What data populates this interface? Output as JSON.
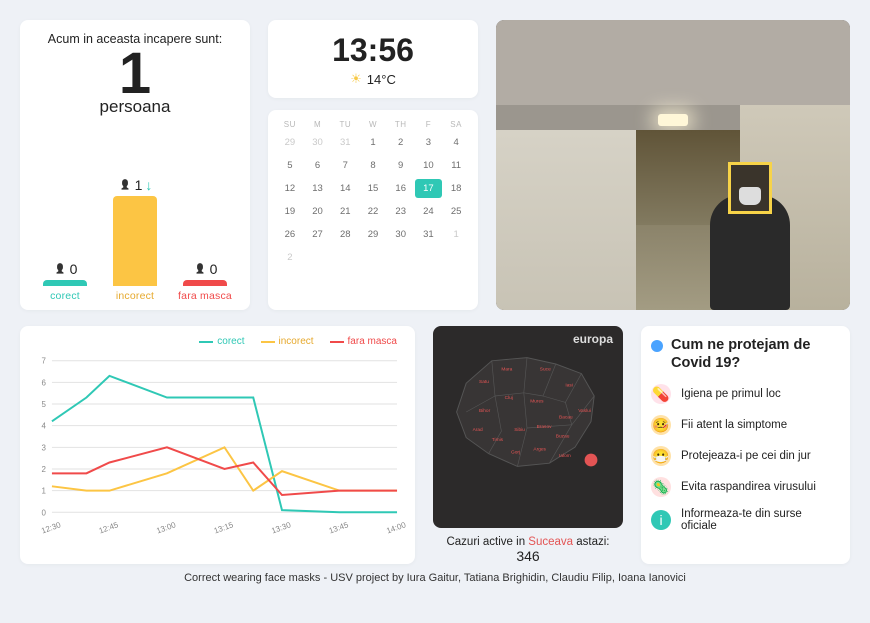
{
  "people_panel": {
    "title": "Acum in aceasta incapere  sunt:",
    "count": "1",
    "unit": "persoana",
    "bars": {
      "corect": {
        "count": "0",
        "label": "corect"
      },
      "incorect": {
        "count": "1",
        "label": "incorect",
        "trend_icon": "arrow-down"
      },
      "nomask": {
        "count": "0",
        "label": "fara masca"
      }
    }
  },
  "clock": {
    "time": "13:56",
    "weather": {
      "icon": "sun-icon",
      "temp": "14°C"
    }
  },
  "calendar": {
    "dow": [
      "SU",
      "M",
      "TU",
      "W",
      "TH",
      "F",
      "SA"
    ],
    "leading_dim": [
      "29",
      "30",
      "31"
    ],
    "days": [
      "1",
      "2",
      "3",
      "4",
      "5",
      "6",
      "7",
      "8",
      "9",
      "10",
      "11",
      "12",
      "13",
      "14",
      "15",
      "16",
      "17",
      "18",
      "19",
      "20",
      "21",
      "22",
      "23",
      "24",
      "25",
      "26",
      "27",
      "28",
      "29",
      "30",
      "31"
    ],
    "trailing_dim": [
      "1",
      "2"
    ],
    "today": "17"
  },
  "chart_panel": {
    "legend": {
      "corect": "corect",
      "incorect": "incorect",
      "nomask": "fara masca"
    }
  },
  "chart_data": {
    "type": "line",
    "title": "",
    "xlabel": "",
    "ylabel": "",
    "ylim": [
      0,
      7
    ],
    "yticks": [
      0,
      1,
      2,
      3,
      4,
      5,
      6,
      7
    ],
    "categories": [
      "12:30",
      "12:45",
      "13:00",
      "13:15",
      "13:30",
      "13:45",
      "14:00"
    ],
    "series": [
      {
        "name": "corect",
        "color": "#2fc8b5",
        "values": [
          4.2,
          5.3,
          6.3,
          5.3,
          5.3,
          5.3,
          0.1,
          0.0,
          0.0
        ]
      },
      {
        "name": "incorect",
        "color": "#fcc544",
        "values": [
          1.2,
          1.0,
          1.0,
          1.8,
          3.0,
          1.0,
          1.9,
          1.0,
          1.0
        ]
      },
      {
        "name": "fara masca",
        "color": "#f04a4a",
        "values": [
          1.8,
          1.8,
          2.3,
          3.0,
          2.0,
          2.3,
          0.8,
          1.0,
          1.0
        ]
      }
    ],
    "x_positions_index": [
      0,
      0.6,
      1,
      2,
      3,
      3.5,
      4,
      5,
      6
    ]
  },
  "map_panel": {
    "brand": "europa",
    "caption_prefix": "Cazuri active in ",
    "caption_region": "Suceava",
    "caption_suffix": " astazi:",
    "caption_value": "346"
  },
  "tips_panel": {
    "title": "Cum ne protejam de Covid 19?",
    "items": [
      {
        "icon": "pill-icon",
        "bg": "#ffe2ea",
        "glyph": "💊",
        "text": "Igiena pe primul loc"
      },
      {
        "icon": "sick-icon",
        "bg": "#ffe2a8",
        "glyph": "🤒",
        "text": "Fii atent la simptome"
      },
      {
        "icon": "mask-icon",
        "bg": "#ffe2a8",
        "glyph": "😷",
        "text": "Protejeaza-i pe cei din jur"
      },
      {
        "icon": "virus-icon",
        "bg": "#ffe0e0",
        "glyph": "🦠",
        "text": "Evita raspandirea virusului"
      },
      {
        "icon": "info-icon",
        "bg": "#2fc8b5",
        "glyph": "i",
        "text": "Informeaza-te din surse oficiale"
      }
    ]
  },
  "footer": "Correct wearing face masks - USV  project by Iura Gaitur, Tatiana Brighidin, Claudiu Filip, Ioana Ianovici"
}
